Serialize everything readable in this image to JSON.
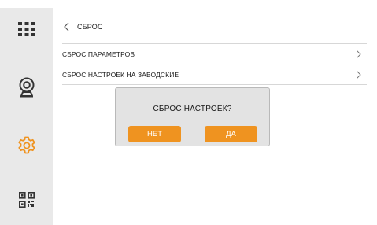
{
  "colors": {
    "accent": "#ef9320",
    "sidebar_bg": "#e9e9e9",
    "dialog_bg": "#e3e3e3",
    "divider": "#d7d7d7"
  },
  "sidebar": {
    "items": [
      {
        "icon": "apps-grid-icon"
      },
      {
        "icon": "webcam-icon"
      },
      {
        "icon": "settings-gear-icon",
        "active": true
      },
      {
        "icon": "qr-code-icon"
      }
    ]
  },
  "header": {
    "back_icon": "chevron-left-icon",
    "title": "СБРОС"
  },
  "menu": {
    "items": [
      {
        "label": "СБРОС ПАРАМЕТРОВ",
        "icon": "chevron-right-icon"
      },
      {
        "label": "СБРОС НАСТРОЕК НА ЗАВОДСКИЕ",
        "icon": "chevron-right-icon"
      }
    ]
  },
  "dialog": {
    "title": "СБРОС НАСТРОЕК?",
    "no_label": "НЕТ",
    "yes_label": "ДА"
  }
}
